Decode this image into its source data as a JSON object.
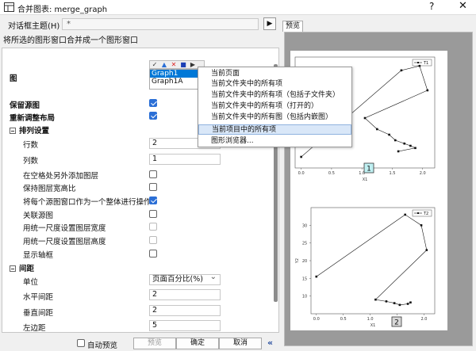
{
  "window": {
    "title": "合并图表: merge_graph",
    "help_glyph": "?",
    "close_glyph": "✕"
  },
  "theme": {
    "label": "对话框主题(H)",
    "value": "*",
    "arrow": "▶"
  },
  "description": "将所选的图形窗口合并成一个图形窗口",
  "preview": {
    "tab_label": "预览"
  },
  "graphs": {
    "label": "图",
    "toolbar_glyphs": [
      "✓",
      "▲",
      "✕",
      "■",
      "▶"
    ],
    "items": [
      "Graph1",
      "Graph1A"
    ],
    "selected_index": 0
  },
  "options": {
    "keep_source": {
      "label": "保留源图",
      "checked": true
    },
    "relayout": {
      "label": "重新调整布局",
      "checked": true
    }
  },
  "arrange": {
    "section": "排列设置",
    "rows": {
      "label": "行数",
      "value": "2"
    },
    "cols": {
      "label": "列数",
      "value": "1"
    },
    "add_layers": {
      "label": "在空格处另外添加图层",
      "checked": false
    },
    "keep_ratio": {
      "label": "保持图层宽高比",
      "checked": false
    },
    "as_whole": {
      "label": "将每个源图窗口作为一个整体进行操作",
      "checked": true
    },
    "link": {
      "label": "关联源图",
      "checked": false
    },
    "uniform_width": {
      "label": "用统一尺度设置图层宽度",
      "checked": false
    },
    "uniform_height": {
      "label": "用统一尺度设置图层高度",
      "checked": false
    },
    "show_frame": {
      "label": "显示轴框",
      "checked": false
    }
  },
  "spacing": {
    "section": "间距",
    "unit": {
      "label": "单位",
      "value": "页面百分比(%)"
    },
    "h_gap": {
      "label": "水平间距",
      "value": "2"
    },
    "v_gap": {
      "label": "垂直间距",
      "value": "2"
    },
    "left": {
      "label": "左边距",
      "value": "5"
    }
  },
  "context_menu": {
    "items": [
      "当前页面",
      "当前文件夹中的所有项",
      "当前文件夹中的所有项（包括子文件夹）",
      "当前文件夹中的所有项（打开的）",
      "当前文件夹中的所有图（包括内嵌图）",
      "当前项目中的所有项",
      "图形浏览器..."
    ],
    "highlighted_index": 5
  },
  "buttons": {
    "auto_preview": {
      "label": "自动预览",
      "checked": false
    },
    "preview": "预览",
    "ok": "确定",
    "cancel": "取消",
    "collapse": "«"
  },
  "chart_data": [
    {
      "type": "line",
      "legend": [
        "T1"
      ],
      "legend_position": "top-right",
      "xticks": [
        "0.0",
        "0.5",
        "1.0",
        "1.5",
        "2.0"
      ],
      "xlabel": "X1",
      "layer_badge": "1",
      "x": [
        0.0,
        1.65,
        1.95,
        2.08,
        1.05,
        1.25,
        1.45,
        1.55,
        1.7,
        1.8,
        1.88,
        1.6
      ],
      "y": [
        0.1,
        0.88,
        0.92,
        0.7,
        0.45,
        0.35,
        0.3,
        0.25,
        0.22,
        0.2,
        0.18,
        0.15
      ],
      "grid": false
    },
    {
      "type": "line",
      "legend": [
        "T2"
      ],
      "legend_position": "top-right",
      "xticks": [
        "0.0",
        "0.5",
        "1.0",
        "1.5",
        "2.0"
      ],
      "yticks": [
        "10",
        "15",
        "20",
        "25",
        "30"
      ],
      "xlabel": "X1",
      "ylabel": "Y2",
      "layer_badge": "2",
      "x": [
        0.0,
        1.65,
        1.95,
        2.05,
        1.1,
        1.3,
        1.45,
        1.55,
        1.7,
        1.75
      ],
      "y": [
        15.5,
        33,
        30,
        23,
        9,
        8.5,
        8,
        7.5,
        7.8,
        8.2
      ],
      "grid": false
    }
  ]
}
